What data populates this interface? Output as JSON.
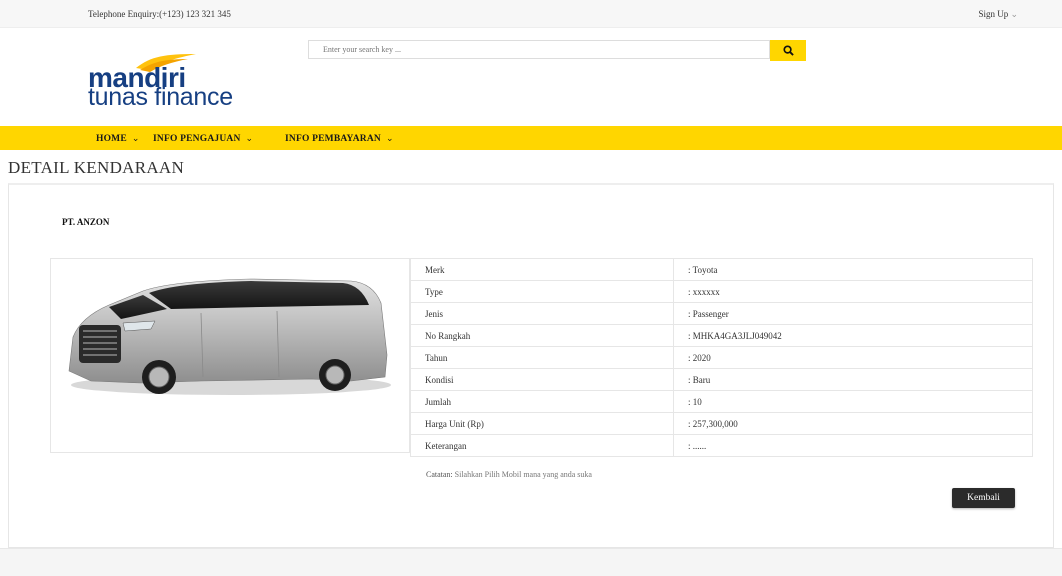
{
  "topbar": {
    "phone": "Telephone Enquiry:(+123) 123 321 345",
    "signup": "Sign Up"
  },
  "brand": {
    "line1": "mandiri",
    "line2": "tunas finance"
  },
  "search": {
    "placeholder": "Enter your search key ..."
  },
  "nav": [
    {
      "label": "HOME"
    },
    {
      "label": "INFO PENGAJUAN"
    },
    {
      "label": "INFO PEMBAYARAN"
    }
  ],
  "page": {
    "title": "DETAIL KENDARAAN",
    "company": "PT. ANZON"
  },
  "specs": [
    {
      "key": "Merk",
      "value": ": Toyota"
    },
    {
      "key": "Type",
      "value": ": xxxxxx"
    },
    {
      "key": "Jenis",
      "value": ": Passenger"
    },
    {
      "key": "No Rangkah",
      "value": ": MHKA4GA3JLJ049042"
    },
    {
      "key": "Tahun",
      "value": ": 2020"
    },
    {
      "key": "Kondisi",
      "value": ": Baru"
    },
    {
      "key": "Jumlah",
      "value": ": 10"
    },
    {
      "key": "Harga Unit (Rp)",
      "value": ": 257,300,000"
    },
    {
      "key": "Keterangan",
      "value": ": ......"
    }
  ],
  "note": {
    "label": "Catatan:",
    "text": "Silahkan Pilih Mobil mana yang anda suka"
  },
  "actions": {
    "back": "Kembali"
  },
  "colors": {
    "accent": "#ffd600",
    "brand": "#163f82",
    "button": "#2b2b2b"
  },
  "icons": {
    "search": "search-icon",
    "chevron": "chevron-down-icon"
  }
}
